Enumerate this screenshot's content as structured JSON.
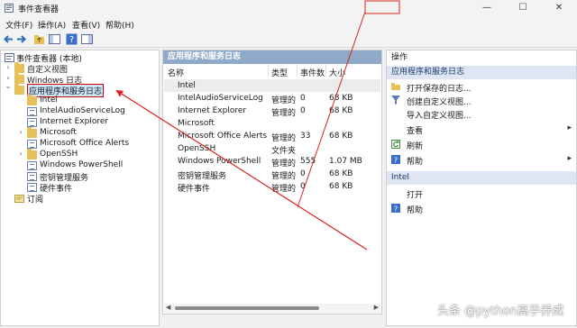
{
  "window": {
    "title": "事件查看器",
    "minimize_glyph": "—",
    "maximize_glyph": "☐",
    "close_glyph": "✕"
  },
  "menu": {
    "file": "文件(F)",
    "action": "操作(A)",
    "view": "查看(V)",
    "help": "帮助(H)"
  },
  "tree": {
    "root": "事件查看器 (本地)",
    "custom_views": "自定义视图",
    "windows_logs": "Windows 日志",
    "app_service_logs": "应用程序和服务日志",
    "children": [
      "Intel",
      "IntelAudioServiceLog",
      "Internet Explorer",
      "Microsoft",
      "Microsoft Office Alerts",
      "OpenSSH",
      "Windows PowerShell",
      "密钥管理服务",
      "硬件事件"
    ],
    "subscriptions": "订阅",
    "expand_glyph": "›",
    "expanded_glyph": "⌄"
  },
  "middle": {
    "header": "应用程序和服务日志",
    "columns": {
      "name": "名称",
      "type": "类型",
      "event_count": "事件数",
      "size": "大小"
    },
    "rows": [
      {
        "name": "Intel",
        "type": "",
        "count": "",
        "size": ""
      },
      {
        "name": "IntelAudioServiceLog",
        "type": "管理的",
        "count": "0",
        "size": "68 KB"
      },
      {
        "name": "Internet Explorer",
        "type": "管理的",
        "count": "0",
        "size": "68 KB"
      },
      {
        "name": "Microsoft",
        "type": "",
        "count": "",
        "size": ""
      },
      {
        "name": "Microsoft Office Alerts",
        "type": "管理的",
        "count": "33",
        "size": "68 KB"
      },
      {
        "name": "OpenSSH",
        "type": "文件夹",
        "count": "",
        "size": ""
      },
      {
        "name": "Windows PowerShell",
        "type": "管理的",
        "count": "555",
        "size": "1.07 MB"
      },
      {
        "name": "密钥管理服务",
        "type": "管理的",
        "count": "0",
        "size": "68 KB"
      },
      {
        "name": "硬件事件",
        "type": "管理的",
        "count": "0",
        "size": "68 KB"
      }
    ],
    "scroll_left": "◀",
    "scroll_right": "▶"
  },
  "actions": {
    "title": "操作",
    "section1": "应用程序和服务日志",
    "items1": [
      {
        "label": "打开保存的日志...",
        "icon": "folder-open-icon",
        "chevron": ""
      },
      {
        "label": "创建自定义视图...",
        "icon": "filter-icon",
        "chevron": ""
      },
      {
        "label": "导入自定义视图...",
        "icon": "",
        "chevron": ""
      },
      {
        "label": "查看",
        "icon": "",
        "chevron": "▸"
      },
      {
        "label": "刷新",
        "icon": "refresh-icon",
        "chevron": ""
      },
      {
        "label": "帮助",
        "icon": "help-icon",
        "chevron": "▸"
      }
    ],
    "section2": "Intel",
    "items2": [
      {
        "label": "打开",
        "icon": "",
        "chevron": ""
      },
      {
        "label": "帮助",
        "icon": "help-icon",
        "chevron": ""
      }
    ]
  },
  "watermark": "头条 @python高手养成",
  "colors": {
    "header_bar": "#8fa9c8",
    "selection_border": "#cc0000",
    "arrow": "#dd2222",
    "section_bg": "#dde6f2"
  }
}
